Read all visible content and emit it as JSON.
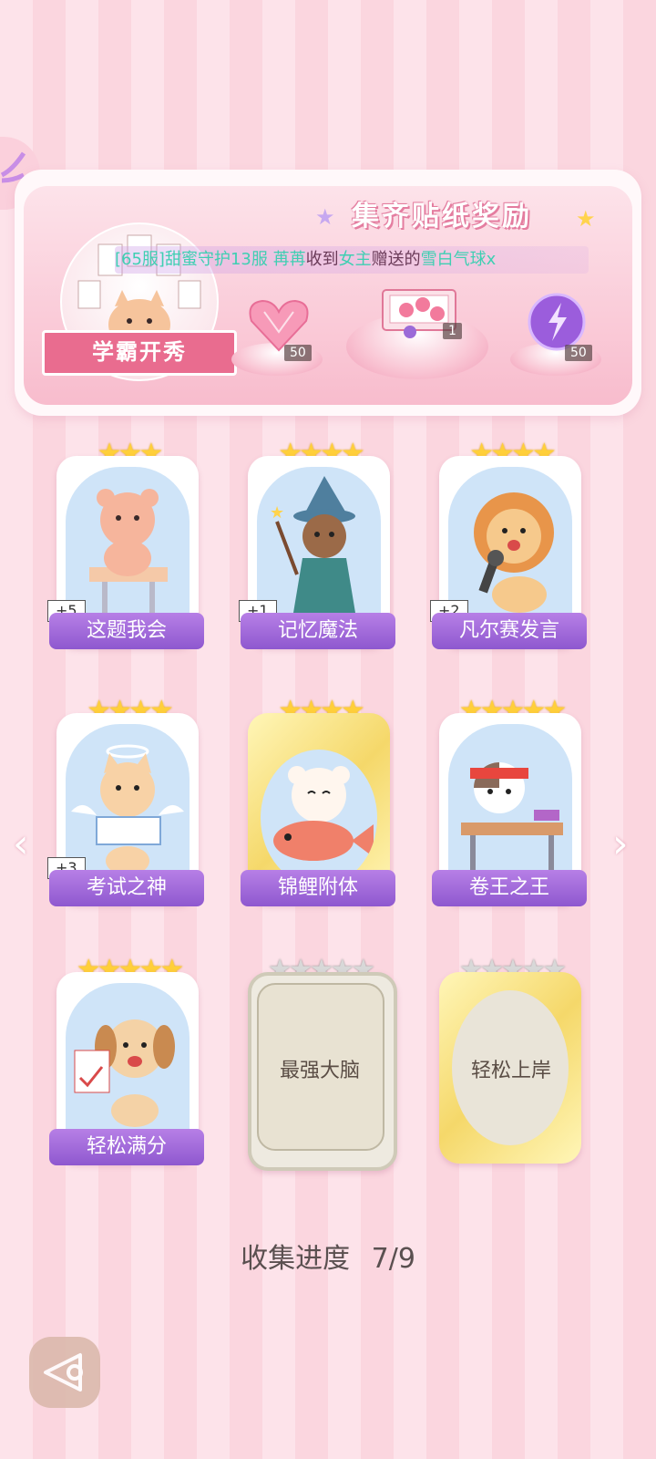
{
  "reward_panel": {
    "title": "集齐贴纸奖励",
    "ticker": {
      "server": "[65服]",
      "group": "甜蜜守护13服",
      "user": "苒苒",
      "verb": "收到",
      "sender": "女主",
      "verb2": "赠送的",
      "gift": "雪白气球x"
    },
    "theme_label": "学霸开秀",
    "rewards": [
      {
        "name": "heart-gem",
        "count": "50"
      },
      {
        "name": "gift-box",
        "count": "1"
      },
      {
        "name": "purple-orb",
        "count": "50"
      }
    ]
  },
  "cards": [
    {
      "label": "这题我会",
      "count": "+5",
      "stars": 3,
      "collected": true
    },
    {
      "label": "记忆魔法",
      "count": "+1",
      "stars": 4,
      "collected": true
    },
    {
      "label": "凡尔赛发言",
      "count": "+2",
      "stars": 4,
      "collected": true
    },
    {
      "label": "考试之神",
      "count": "+3",
      "stars": 4,
      "collected": true
    },
    {
      "label": "锦鲤附体",
      "count": "",
      "stars": 4,
      "collected": true
    },
    {
      "label": "卷王之王",
      "count": "",
      "stars": 5,
      "collected": true
    },
    {
      "label": "轻松满分",
      "count": "",
      "stars": 5,
      "collected": true
    },
    {
      "label": "最强大脑",
      "count": "",
      "stars": 5,
      "collected": false
    },
    {
      "label": "轻松上岸",
      "count": "",
      "stars": 5,
      "collected": false
    }
  ],
  "progress": {
    "label": "收集进度",
    "value": "7/9"
  },
  "colors": {
    "accent": "#8e58cf",
    "pink": "#e96c8f",
    "star": "#ffcf3a"
  }
}
